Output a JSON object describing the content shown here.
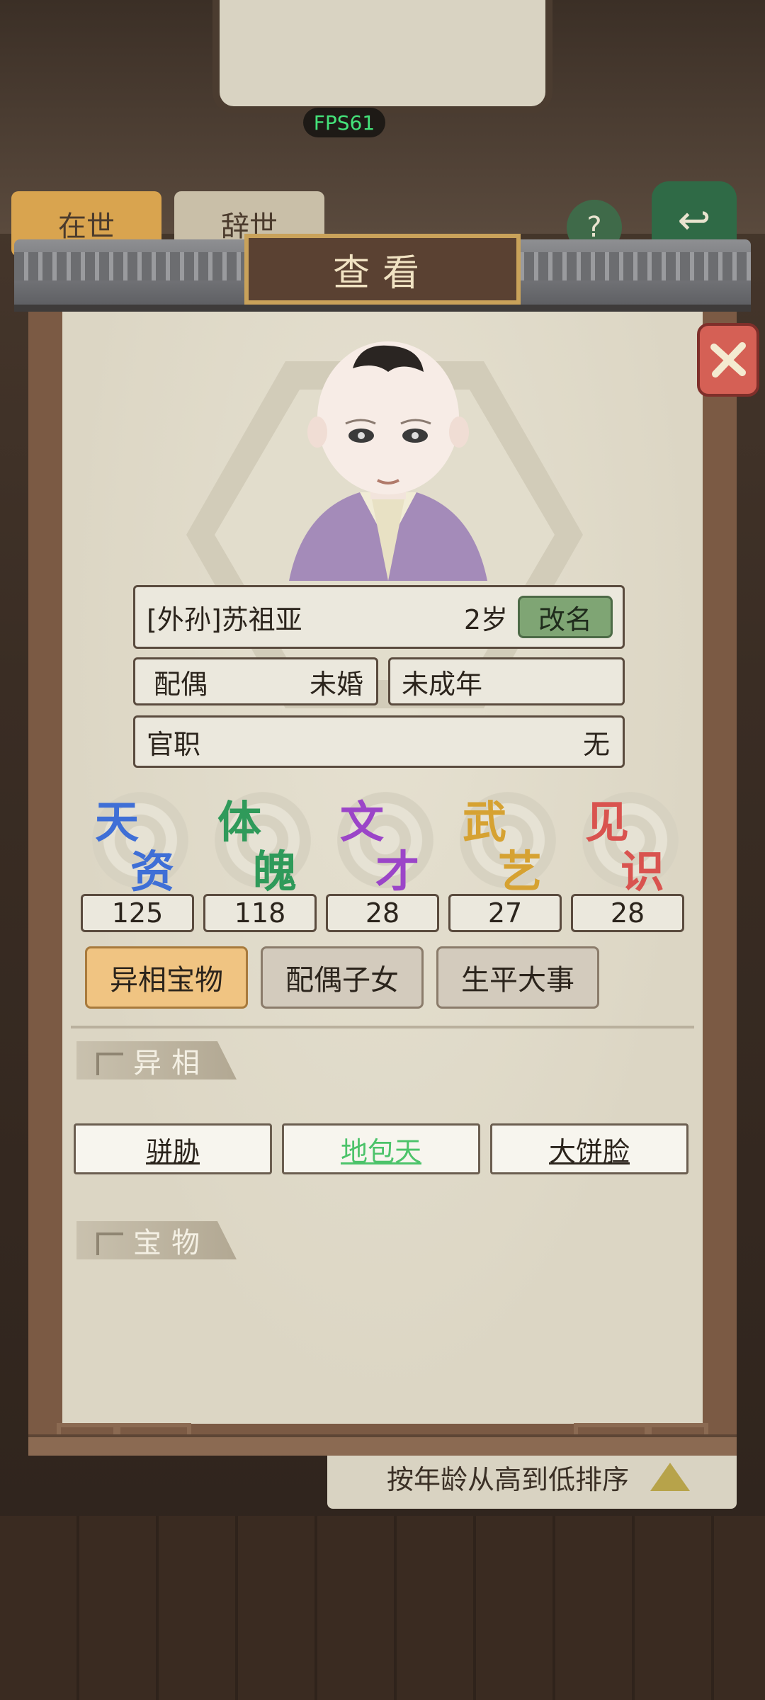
{
  "hud": {
    "fps": "FPS61"
  },
  "background": {
    "tabs": [
      "在世",
      "辞世"
    ],
    "help_icon": "question-icon",
    "back_icon": "back-arrow-icon",
    "sort_label": "按年龄从高到低排序"
  },
  "dialog": {
    "title": "查看",
    "close_icon": "close-brush-icon",
    "profile": {
      "name": "[外孙]苏祖亚",
      "age": "2岁",
      "rename_label": "改名",
      "spouse_label": "配偶",
      "spouse_value": "未婚",
      "status": "未成年",
      "office_label": "官职",
      "office_value": "无"
    },
    "stats": [
      {
        "c1": "天",
        "c2": "资",
        "value": "125",
        "color": "#3f6fd6"
      },
      {
        "c1": "体",
        "c2": "魄",
        "value": "118",
        "color": "#2f9a5a"
      },
      {
        "c1": "文",
        "c2": "才",
        "value": "28",
        "color": "#9b45c8"
      },
      {
        "c1": "武",
        "c2": "艺",
        "value": "27",
        "color": "#d6a232"
      },
      {
        "c1": "见",
        "c2": "识",
        "value": "28",
        "color": "#d9534f"
      }
    ],
    "tabs": [
      "异相宝物",
      "配偶子女",
      "生平大事"
    ],
    "section_traits": "异相",
    "traits": [
      {
        "label": "骈胁",
        "color": "#2b241c"
      },
      {
        "label": "地包天",
        "color": "#4cc36a"
      },
      {
        "label": "大饼脸",
        "color": "#2b241c"
      }
    ],
    "section_treasures": "宝物"
  }
}
